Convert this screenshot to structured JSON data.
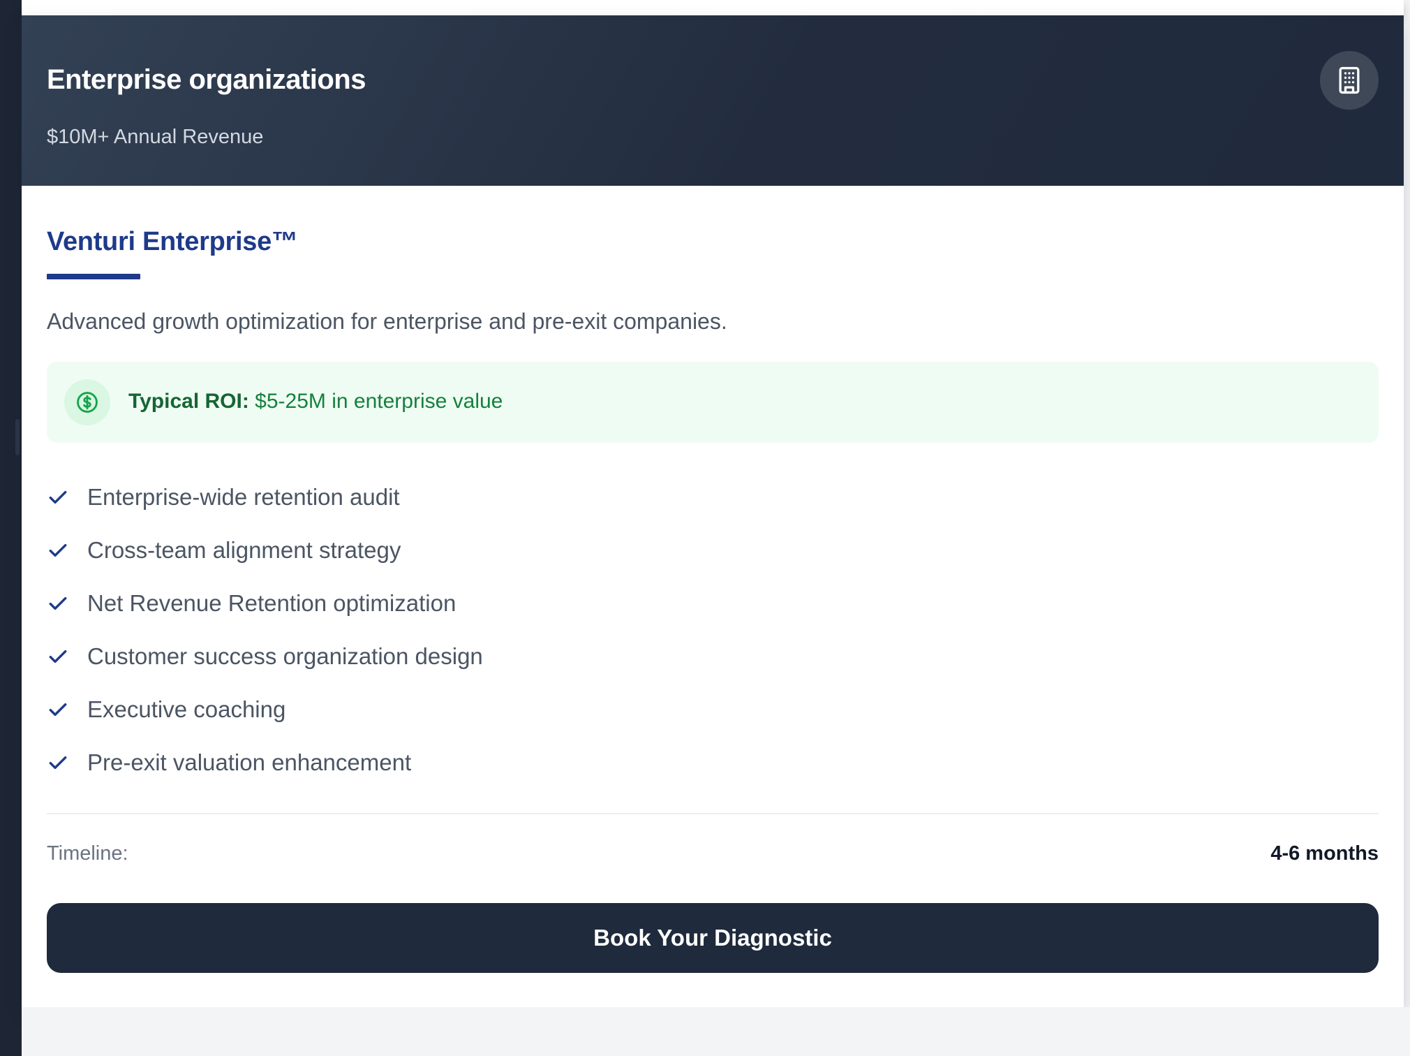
{
  "header": {
    "title": "Enterprise organizations",
    "subtitle": "$10M+ Annual Revenue",
    "icon": "building-icon"
  },
  "plan": {
    "name": "Venturi Enterprise™",
    "description": "Advanced growth optimization for enterprise and pre-exit companies."
  },
  "roi": {
    "icon": "dollar-circle-icon",
    "label": "Typical ROI:",
    "value": "$5-25M in enterprise value"
  },
  "features": [
    "Enterprise-wide retention audit",
    "Cross-team alignment strategy",
    "Net Revenue Retention optimization",
    "Customer success organization design",
    "Executive coaching",
    "Pre-exit valuation enhancement"
  ],
  "timeline": {
    "label": "Timeline:",
    "value": "4-6 months"
  },
  "cta": {
    "label": "Book Your Diagnostic"
  },
  "colors": {
    "header_bg": "#222c3e",
    "accent": "#1e3a8a",
    "roi_bg": "#effcf3",
    "roi_text": "#15803d",
    "cta_bg": "#1f2a3c"
  }
}
